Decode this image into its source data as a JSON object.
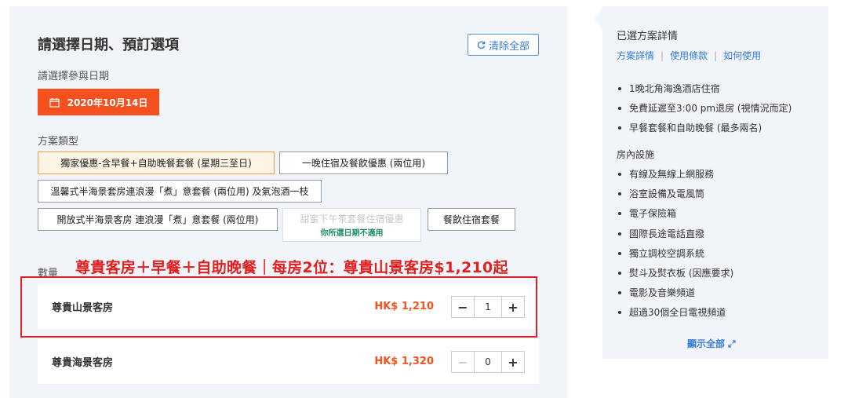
{
  "booking": {
    "title": "請選擇日期、預訂選項",
    "clear_label": "清除全部",
    "date_label": "請選擇參與日期",
    "date_value": "2020年10月14日",
    "plan_label": "方案類型",
    "options": [
      {
        "label": "獨家優惠-含早餐+自助晚餐套餐 (星期三至日)",
        "selected": true
      },
      {
        "label": "一晚住宿及餐飲優惠 (兩位用)",
        "selected": false
      },
      {
        "label": "溫馨式半海景套房連浪漫「煮」意套餐 (兩位用) 及氣泡酒一枝",
        "selected": false
      },
      {
        "label": "開放式半海景客房 連浪漫「煮」意套餐 (兩位用)",
        "selected": false
      },
      {
        "label": "甜蜜下午茶套餐住宿優惠",
        "sub": "你所選日期不適用",
        "disabled": true
      },
      {
        "label": "餐飲住宿套餐",
        "selected": false
      }
    ],
    "qty_label": "數量",
    "overlay_text": "尊貴客房＋早餐＋自助晚餐｜每房2位：尊貴山景客房$1,210起",
    "rooms": [
      {
        "name": "尊貴山景客房",
        "price": "HK$ 1,210",
        "qty": "1"
      },
      {
        "name": "尊貴海景客房",
        "price": "HK$ 1,320",
        "qty": "0"
      }
    ]
  },
  "details": {
    "title": "已選方案詳情",
    "links": [
      "方案詳情",
      "使用條款",
      "如何使用"
    ],
    "includes": [
      "1晚北角海逸酒店住宿",
      "免費延遲至3:00 pm退房 (視情況而定)",
      "早餐套餐和自助晚餐 (最多兩名)"
    ],
    "facilities_title": "房內設施",
    "facilities": [
      "有線及無線上網服務",
      "浴室設備及電風筒",
      "電子保險箱",
      "國際長途電話直撥",
      "獨立調校空調系統",
      "熨斗及熨衣板 (因應要求)",
      "電影及音樂頻道",
      "超過30個全日電視頻道"
    ],
    "show_all": "顯示全部"
  }
}
